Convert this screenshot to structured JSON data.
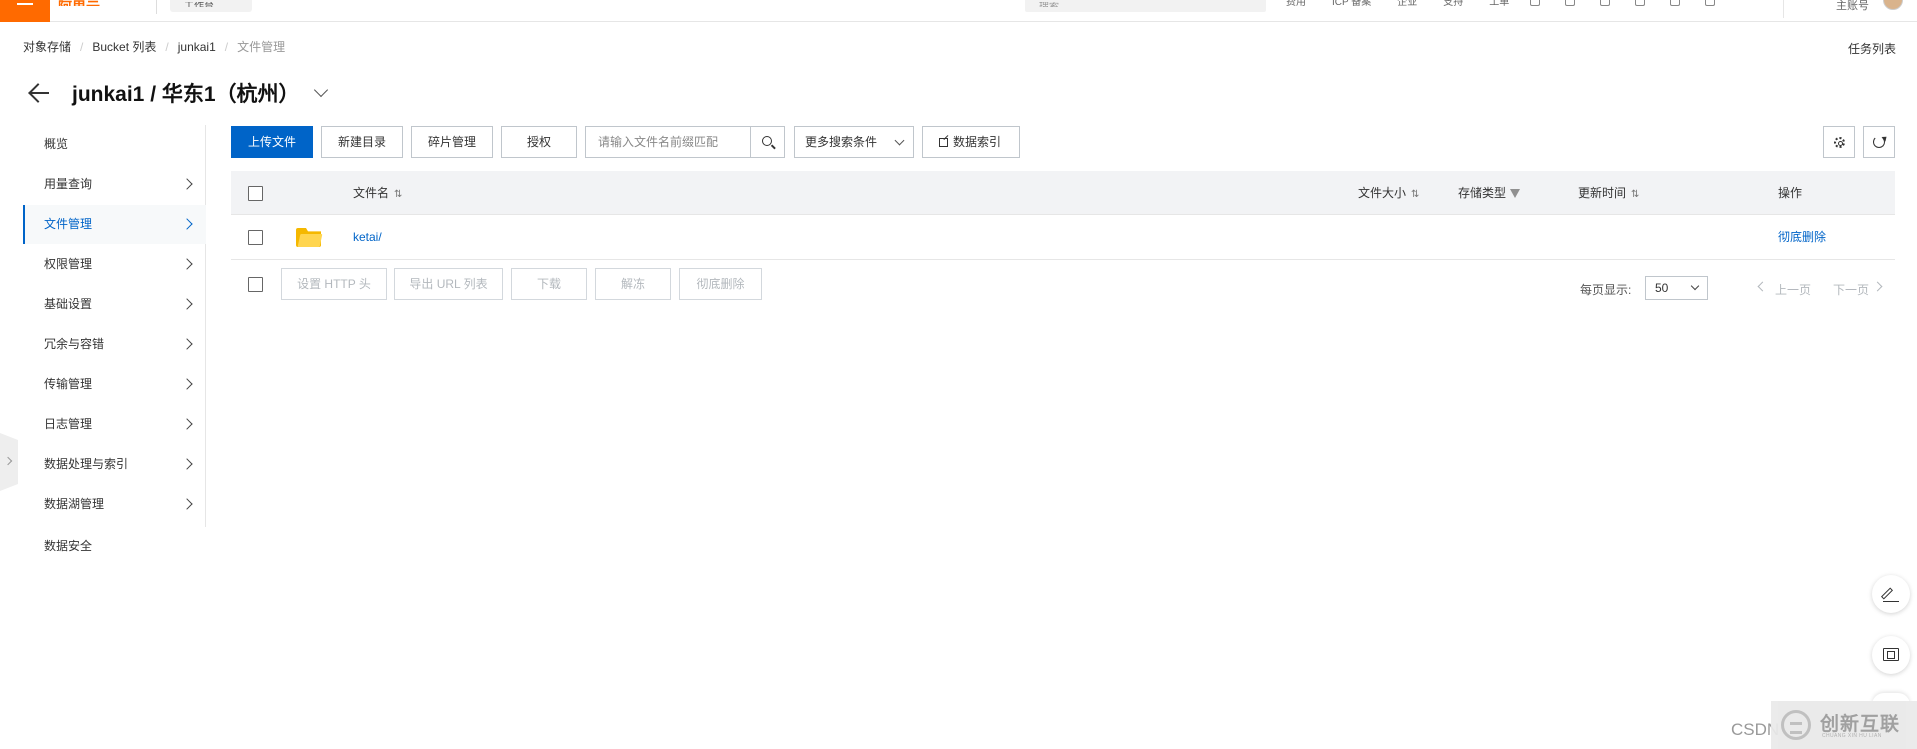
{
  "topbar": {
    "logo_text": "阿里云",
    "workspace_label": "工作台",
    "search_placeholder": "搜索...",
    "links": [
      "费用",
      "ICP 备案",
      "企业",
      "支持",
      "工单"
    ],
    "user_label": "主账号"
  },
  "breadcrumb": {
    "items": [
      "对象存储",
      "Bucket 列表",
      "junkai1"
    ],
    "current": "文件管理"
  },
  "task_list": "任务列表",
  "title": "junkai1 / 华东1（杭州）",
  "sidebar": {
    "items": [
      {
        "label": "概览",
        "has_chevron": false,
        "active": false
      },
      {
        "label": "用量查询",
        "has_chevron": true,
        "active": false
      },
      {
        "label": "文件管理",
        "has_chevron": true,
        "active": true
      },
      {
        "label": "权限管理",
        "has_chevron": true,
        "active": false
      },
      {
        "label": "基础设置",
        "has_chevron": true,
        "active": false
      },
      {
        "label": "冗余与容错",
        "has_chevron": true,
        "active": false
      },
      {
        "label": "传输管理",
        "has_chevron": true,
        "active": false
      },
      {
        "label": "日志管理",
        "has_chevron": true,
        "active": false
      },
      {
        "label": "数据处理与索引",
        "has_chevron": true,
        "active": false
      },
      {
        "label": "数据湖管理",
        "has_chevron": true,
        "active": false
      },
      {
        "label": "数据安全",
        "has_chevron": false,
        "active": false
      }
    ]
  },
  "toolbar": {
    "upload": "上传文件",
    "new_dir": "新建目录",
    "fragments": "碎片管理",
    "authorize": "授权",
    "search_placeholder": "请输入文件名前缀匹配",
    "more_filters": "更多搜索条件",
    "data_index": "数据索引"
  },
  "table": {
    "columns": {
      "name": "文件名",
      "size": "文件大小",
      "storage_type": "存储类型",
      "updated": "更新时间",
      "actions": "操作"
    },
    "rows": [
      {
        "name": "ketai/",
        "size": "",
        "storage_type": "",
        "updated": "",
        "action": "彻底删除"
      }
    ]
  },
  "bulk_actions": {
    "set_http_header": "设置 HTTP 头",
    "export_url": "导出 URL 列表",
    "download": "下载",
    "unfreeze": "解冻",
    "delete": "彻底删除"
  },
  "pagination": {
    "per_page_label": "每页显示:",
    "per_page_value": "50",
    "prev": "上一页",
    "next": "下一页"
  },
  "watermark": {
    "csdn": "CSDN",
    "brand": "创新互联",
    "brand_sub": "CHUANG XIN HU LIAN"
  },
  "colors": {
    "primary": "#0064c8",
    "brand_orange": "#ff6a00",
    "folder": "#f5b800"
  }
}
